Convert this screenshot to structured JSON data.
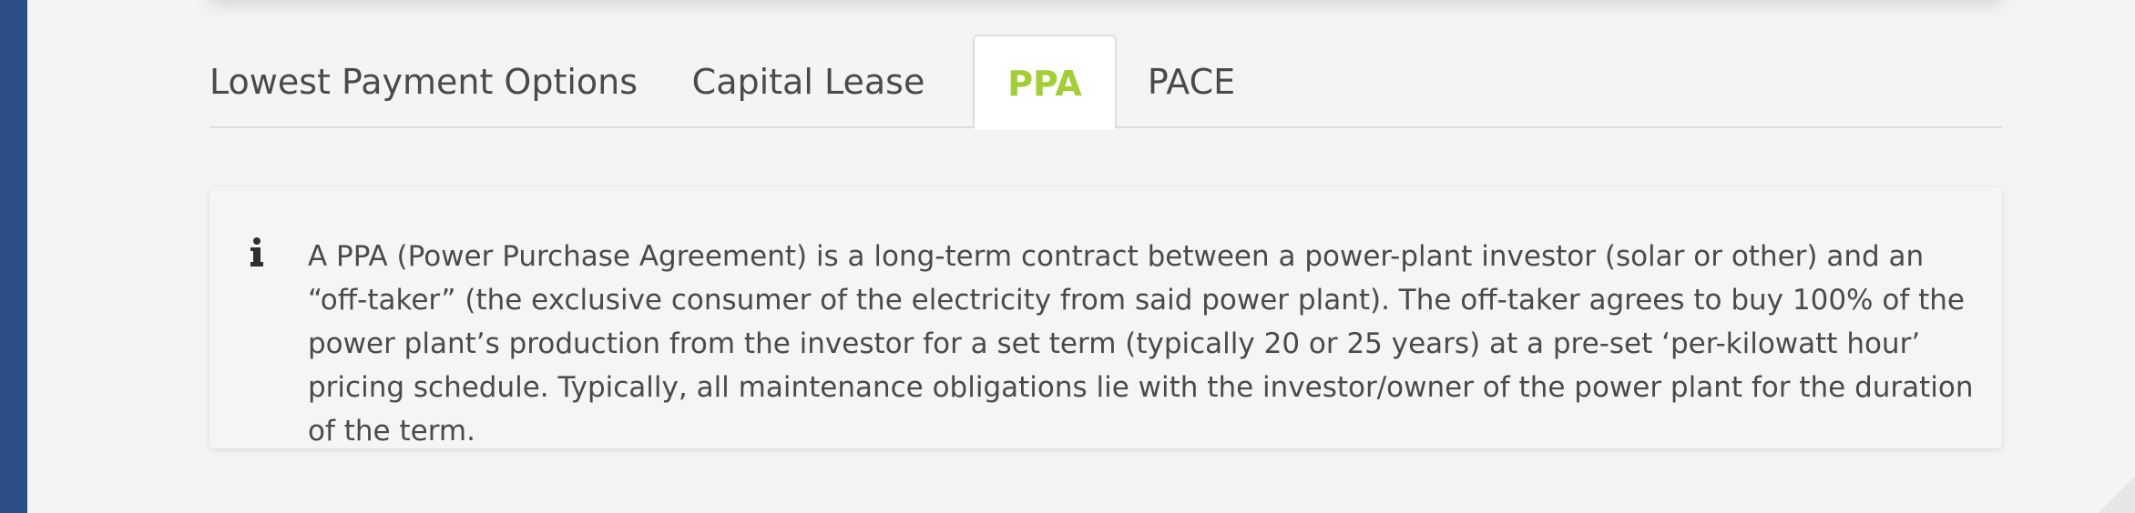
{
  "tabs": [
    {
      "label": "Lowest Payment Options",
      "active": false
    },
    {
      "label": "Capital Lease",
      "active": false
    },
    {
      "label": "PPA",
      "active": true
    },
    {
      "label": "PACE",
      "active": false
    }
  ],
  "info": {
    "icon": "info-icon",
    "text": "A PPA (Power Purchase Agreement) is a long-term contract between a power-plant investor (solar or other) and an “off-taker” (the exclusive consumer of the electricity from said power plant). The off-taker agrees to buy 100% of the power plant’s production from the investor for a set term (typically 20 or 25 years) at a pre-set ‘per-kilowatt hour’ pricing schedule. Typically, all maintenance obligations lie with the investor/owner of the power plant for the duration of the term."
  },
  "colors": {
    "accent": "#a2cf34",
    "rail": "#2b4f86",
    "text": "#4a4a4a"
  }
}
